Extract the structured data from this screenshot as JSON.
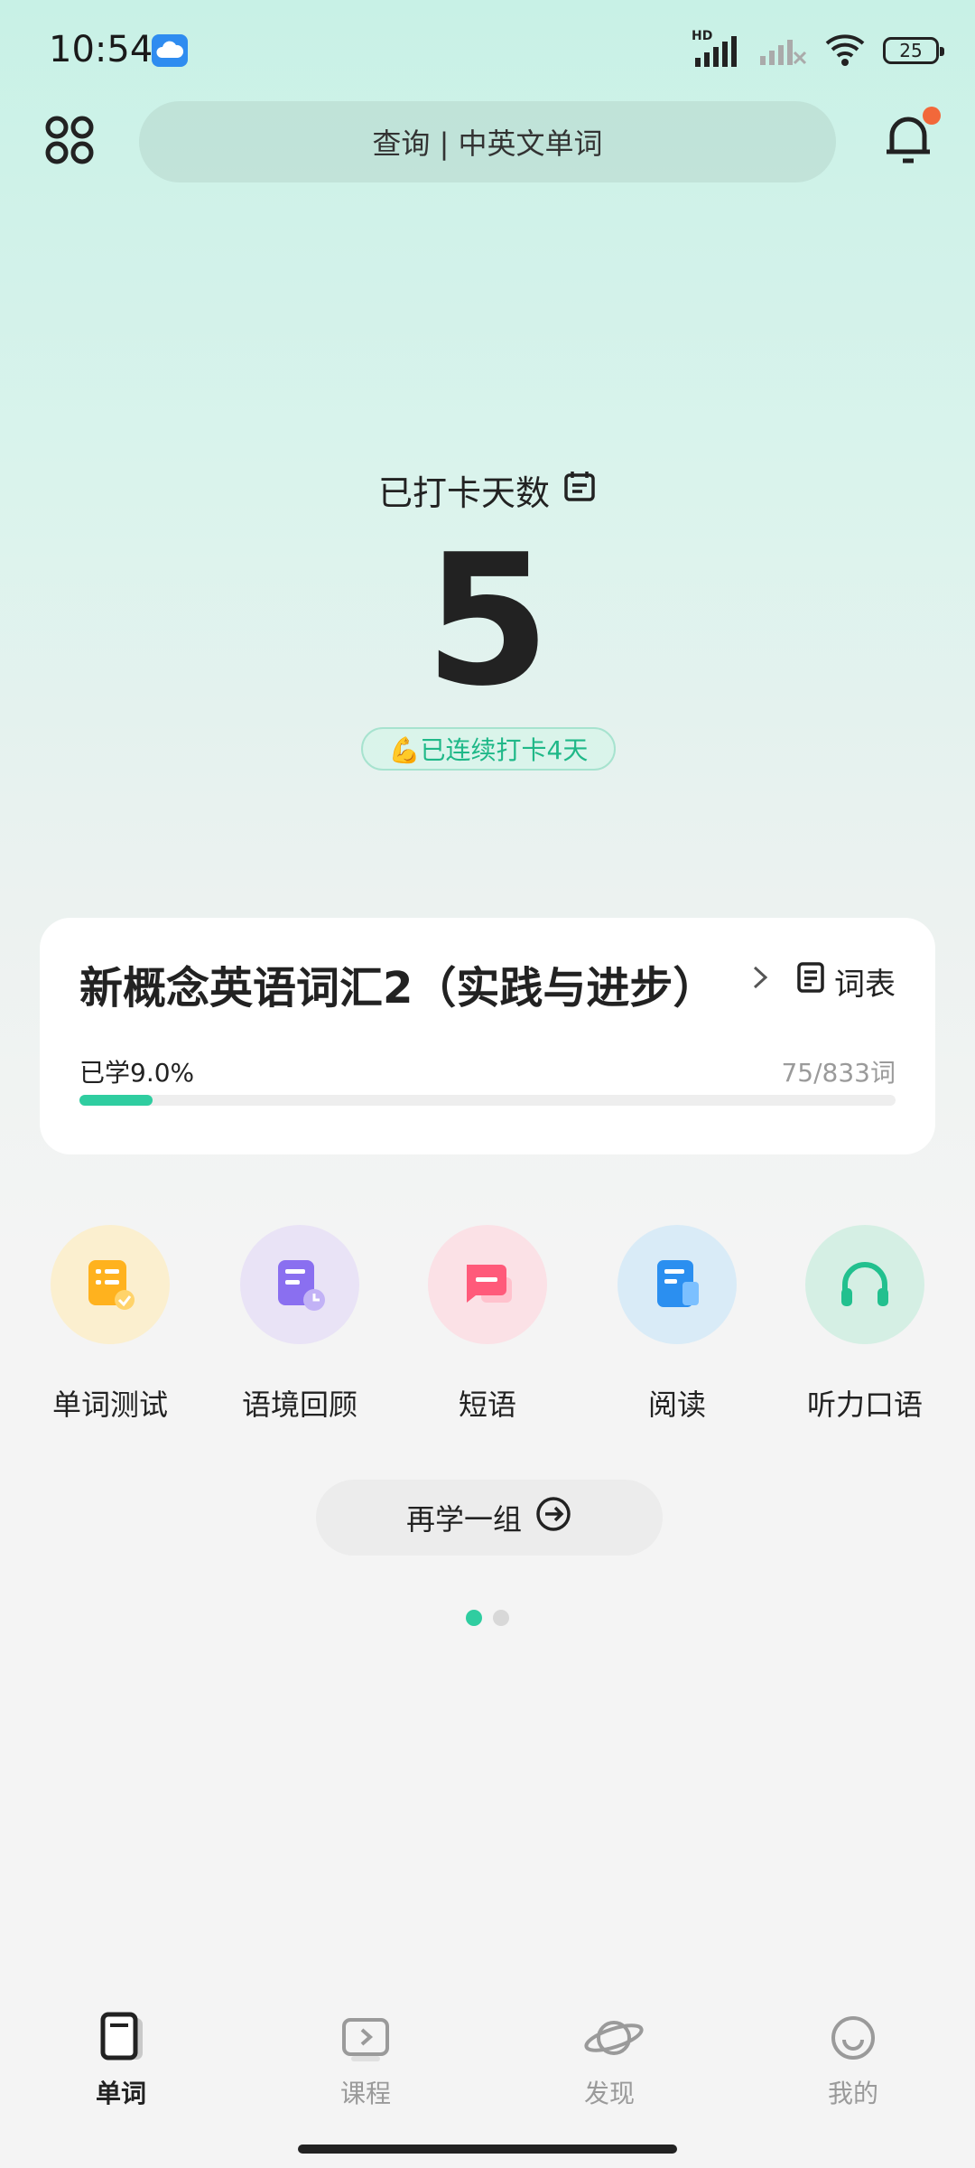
{
  "status_bar": {
    "time": "10:54",
    "battery": "25",
    "network": "HD"
  },
  "header": {
    "search_placeholder": "查询 | 中英文单词"
  },
  "checkin": {
    "title": "已打卡天数",
    "days": "5",
    "streak": "💪已连续打卡4天"
  },
  "book": {
    "title": "新概念英语词汇2（实践与进步）",
    "wordlist_label": "词表",
    "progress_label": "已学9.0%",
    "progress_count": "75/833词",
    "progress_fraction": 0.09
  },
  "features": [
    {
      "label": "单词测试",
      "icon": "word-test-icon",
      "color": "#ffb21e"
    },
    {
      "label": "语境回顾",
      "icon": "context-review-icon",
      "color": "#8a6ff0"
    },
    {
      "label": "短语",
      "icon": "phrase-icon",
      "color": "#ff5a7a"
    },
    {
      "label": "阅读",
      "icon": "reading-icon",
      "color": "#2b8ff0"
    },
    {
      "label": "听力口语",
      "icon": "headphones-icon",
      "color": "#22c08e"
    }
  ],
  "again_label": "再学一组",
  "nav": [
    {
      "label": "单词",
      "active": true
    },
    {
      "label": "课程",
      "active": false
    },
    {
      "label": "发现",
      "active": false
    },
    {
      "label": "我的",
      "active": false
    }
  ],
  "colors": {
    "accent": "#2fcda0",
    "notification": "#f2683a"
  }
}
